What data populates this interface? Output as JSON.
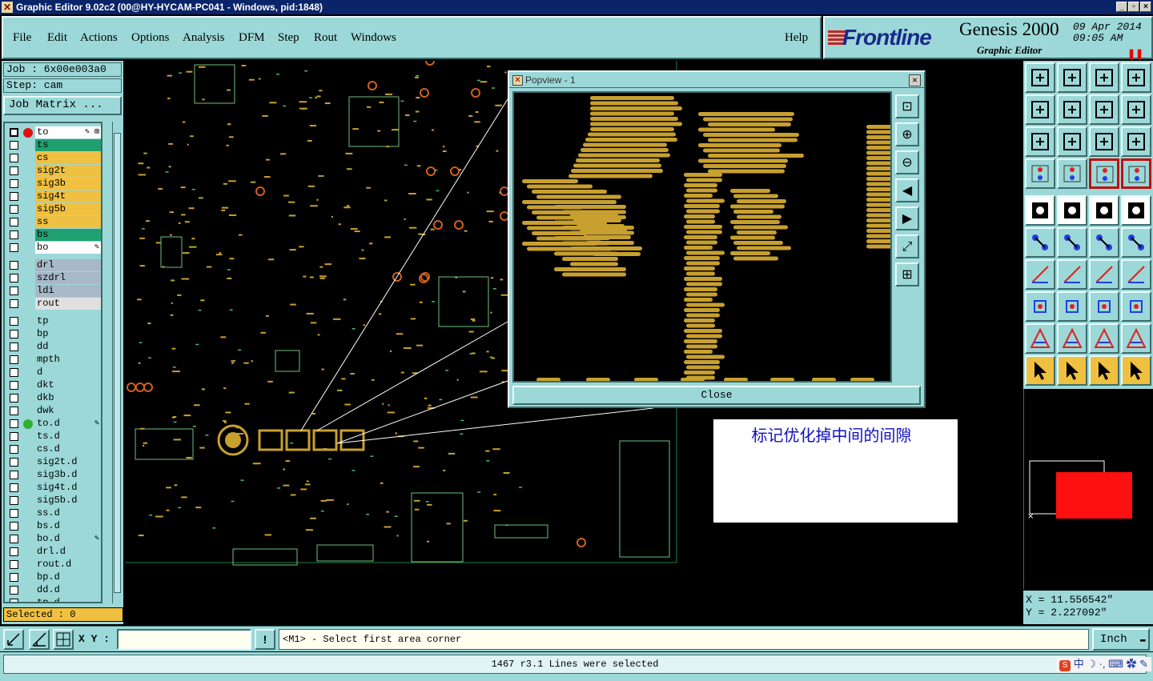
{
  "window": {
    "title": "Graphic Editor 9.02c2 (00@HY-HYCAM-PC041 - Windows, pid:1848)",
    "min_label": "_",
    "max_label": "▫",
    "close_label": "×"
  },
  "menu": {
    "items": [
      "File",
      "Edit",
      "Actions",
      "Options",
      "Analysis",
      "DFM",
      "Step",
      "Rout",
      "Windows"
    ],
    "help": "Help"
  },
  "brand": {
    "logo": "Frontline",
    "product": "Genesis 2000",
    "subtitle": "Graphic Editor",
    "date": "09 Apr 2014",
    "time": "09:05 AM",
    "pause_glyph": "❚❚"
  },
  "job": {
    "job_line": "Job : 6x00e003a0",
    "step_line": "Step: cam",
    "matrix_button": "Job Matrix ..."
  },
  "layers": [
    {
      "name": "to",
      "bg": "#ffffff",
      "dot": "#e01010",
      "active": true,
      "mark": "✎ ⊞"
    },
    {
      "name": "ts",
      "bg": "#20a070"
    },
    {
      "name": "cs",
      "bg": "#f0c040"
    },
    {
      "name": "sig2t",
      "bg": "#f0c040"
    },
    {
      "name": "sig3b",
      "bg": "#f0c040"
    },
    {
      "name": "sig4t",
      "bg": "#f0c040"
    },
    {
      "name": "sig5b",
      "bg": "#f0c040"
    },
    {
      "name": "ss",
      "bg": "#f0c040"
    },
    {
      "name": "bs",
      "bg": "#20a070"
    },
    {
      "name": "bo",
      "bg": "#ffffff",
      "mark": "✎"
    },
    {
      "name": "drl",
      "bg": "#a8b8c8",
      "gap": true
    },
    {
      "name": "szdrl",
      "bg": "#a8b8c8"
    },
    {
      "name": "ldi",
      "bg": "#a8b8c8"
    },
    {
      "name": "rout",
      "bg": "#e0e0e0"
    },
    {
      "name": "tp",
      "bg": "#9cd8d8",
      "gap": true
    },
    {
      "name": "bp",
      "bg": "#9cd8d8"
    },
    {
      "name": "dd",
      "bg": "#9cd8d8"
    },
    {
      "name": "mpth",
      "bg": "#9cd8d8"
    },
    {
      "name": "d",
      "bg": "#9cd8d8"
    },
    {
      "name": "dkt",
      "bg": "#9cd8d8"
    },
    {
      "name": "dkb",
      "bg": "#9cd8d8"
    },
    {
      "name": "dwk",
      "bg": "#9cd8d8"
    },
    {
      "name": "to.d",
      "bg": "#9cd8d8",
      "dot": "#30b030",
      "mark": "✎"
    },
    {
      "name": "ts.d",
      "bg": "#9cd8d8"
    },
    {
      "name": "cs.d",
      "bg": "#9cd8d8"
    },
    {
      "name": "sig2t.d",
      "bg": "#9cd8d8"
    },
    {
      "name": "sig3b.d",
      "bg": "#9cd8d8"
    },
    {
      "name": "sig4t.d",
      "bg": "#9cd8d8"
    },
    {
      "name": "sig5b.d",
      "bg": "#9cd8d8"
    },
    {
      "name": "ss.d",
      "bg": "#9cd8d8"
    },
    {
      "name": "bs.d",
      "bg": "#9cd8d8"
    },
    {
      "name": "bo.d",
      "bg": "#9cd8d8",
      "mark": "✎"
    },
    {
      "name": "drl.d",
      "bg": "#9cd8d8"
    },
    {
      "name": "rout.d",
      "bg": "#9cd8d8"
    },
    {
      "name": "bp.d",
      "bg": "#9cd8d8"
    },
    {
      "name": "dd.d",
      "bg": "#9cd8d8"
    },
    {
      "name": "tp.d",
      "bg": "#9cd8d8"
    }
  ],
  "selected_line": "Selected : 0",
  "popview": {
    "title": "Popview - 1",
    "close_button": "Close",
    "close_x": "×",
    "tools": [
      "zoom-window-icon",
      "zoom-in-icon",
      "zoom-out-icon",
      "pan-left-icon",
      "pan-right-icon",
      "zoom-extents-icon",
      "fit-icon"
    ]
  },
  "note": {
    "text": "标记优化掉中间的间隙"
  },
  "coords": {
    "x_line": "X =  11.556542\"",
    "y_line": "Y =  2.227092\""
  },
  "command": {
    "xy_label": "X Y :",
    "xy_value": "",
    "bang": "!",
    "prompt": "<M1> - Select first area corner",
    "unit": "Inch",
    "unit_caret": "▬"
  },
  "status": {
    "message": "1467 r3.1 Lines were selected",
    "ime": "中 ☽ ·, ⌨ ✿ ✎"
  },
  "colors": {
    "panel": "#9cd8d8",
    "copper": "#c8a030",
    "accent_red": "#e01010"
  }
}
